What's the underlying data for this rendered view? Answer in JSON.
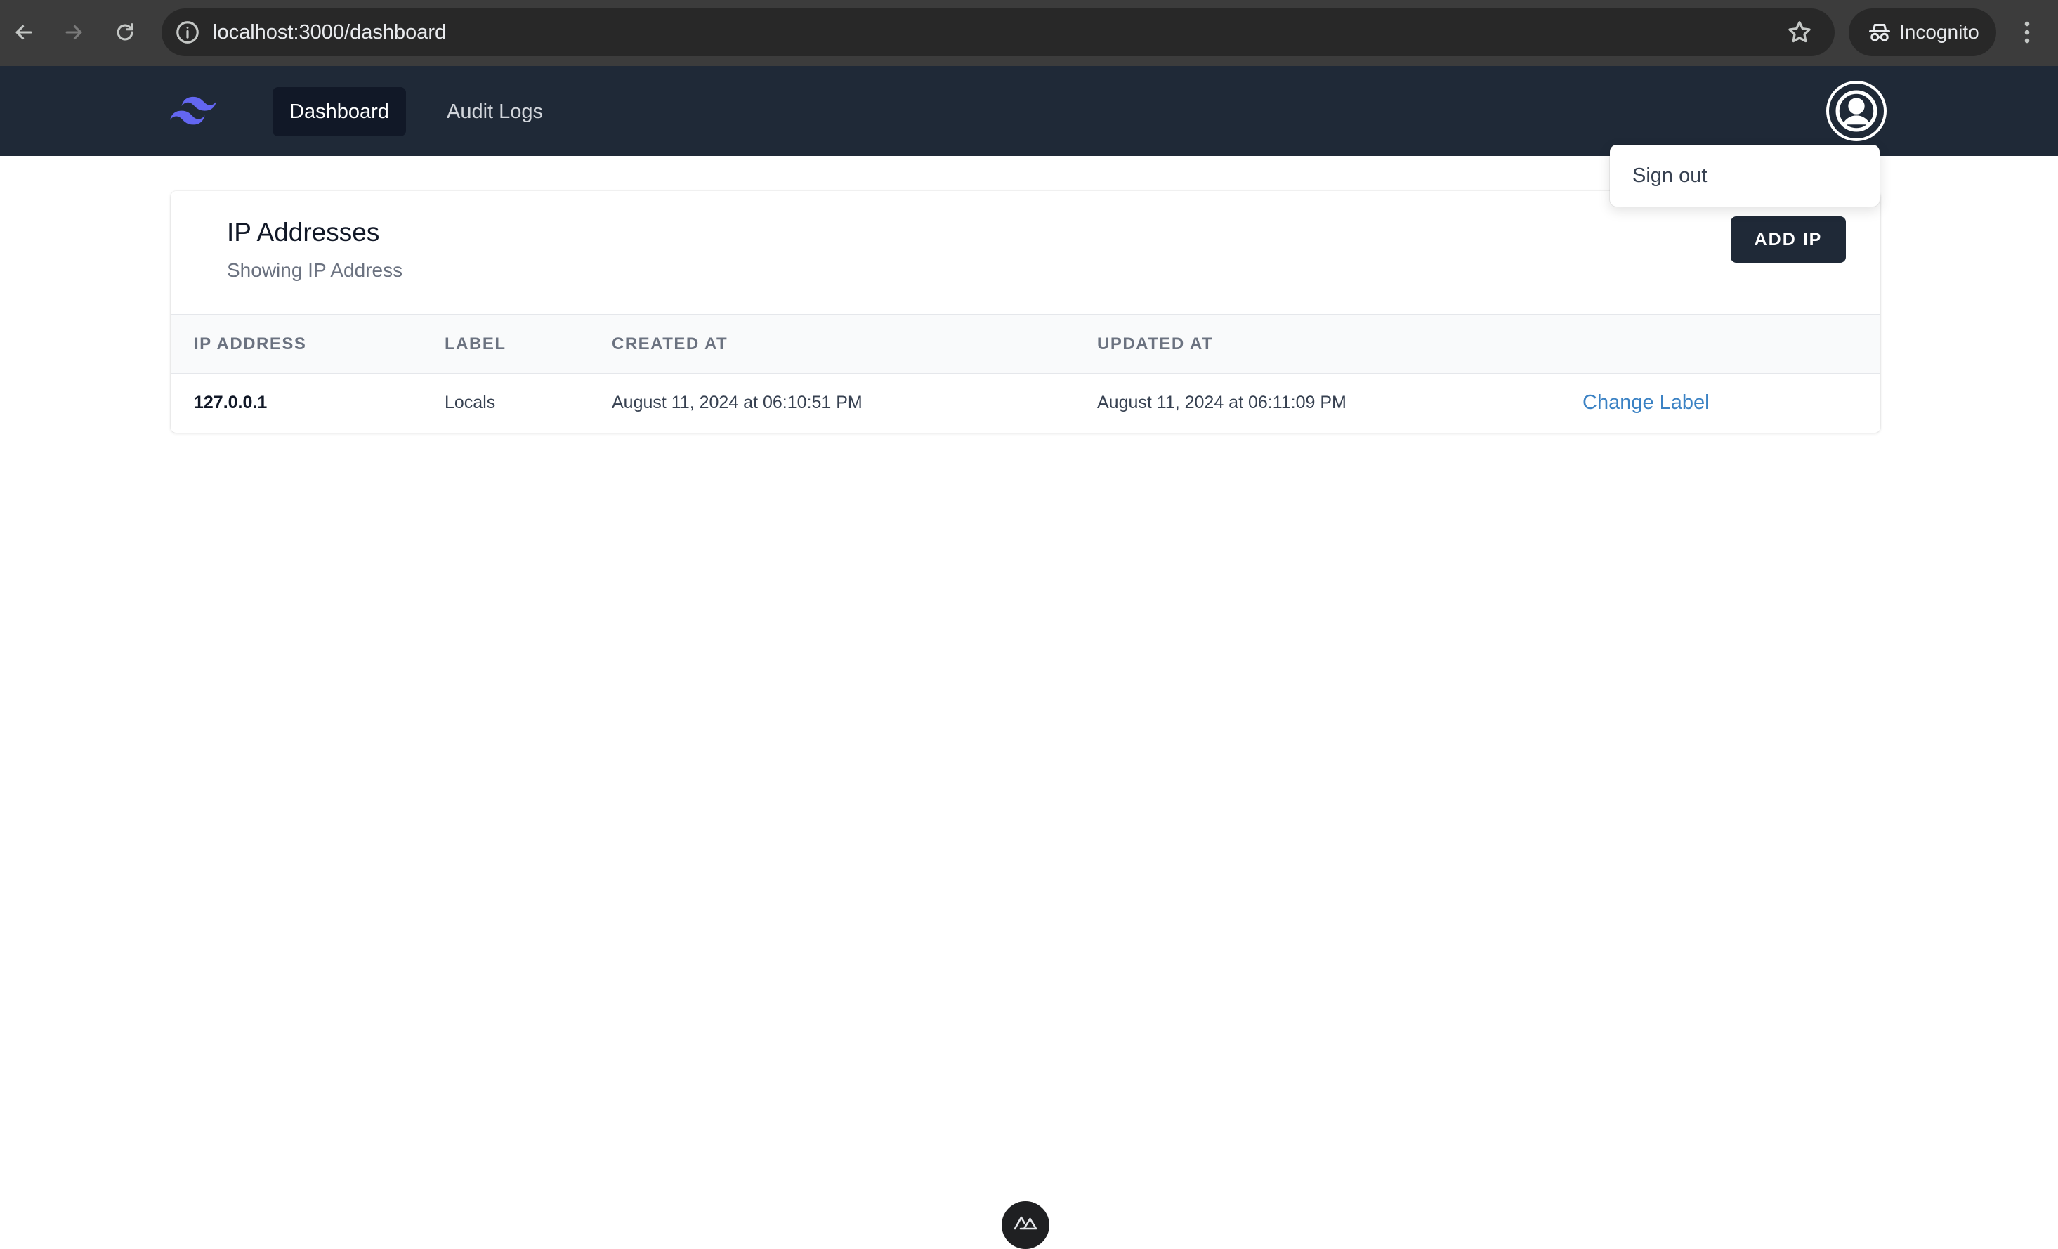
{
  "browser": {
    "url": "localhost:3000/dashboard",
    "profile_label": "Incognito"
  },
  "nav": {
    "links": [
      {
        "label": "Dashboard",
        "active": true
      },
      {
        "label": "Audit Logs",
        "active": false
      }
    ]
  },
  "user_menu": {
    "items": [
      {
        "label": "Sign out"
      }
    ]
  },
  "card": {
    "title": "IP Addresses",
    "subtitle": "Showing IP Address",
    "add_button_label": "ADD IP"
  },
  "table": {
    "columns": [
      "IP ADDRESS",
      "LABEL",
      "CREATED AT",
      "UPDATED AT"
    ],
    "rows": [
      {
        "ip": "127.0.0.1",
        "label": "Locals",
        "created_at": "August 11, 2024 at 06:10:51 PM",
        "updated_at": "August 11, 2024 at 06:11:09 PM",
        "action_label": "Change Label"
      }
    ]
  },
  "colors": {
    "nav_bg": "#1f2937",
    "link_accent": "#3b82c4",
    "brand": "#6366f1"
  },
  "icons": {
    "back": "arrow-left-icon",
    "forward": "arrow-right-icon",
    "reload": "reload-icon",
    "site_info": "info-icon",
    "bookmark": "star-icon",
    "incognito": "incognito-icon",
    "menu": "kebab-menu-icon",
    "brand": "tailwind-logo-icon",
    "user": "user-circle-icon",
    "devtools": "nuxt-devtools-icon"
  }
}
